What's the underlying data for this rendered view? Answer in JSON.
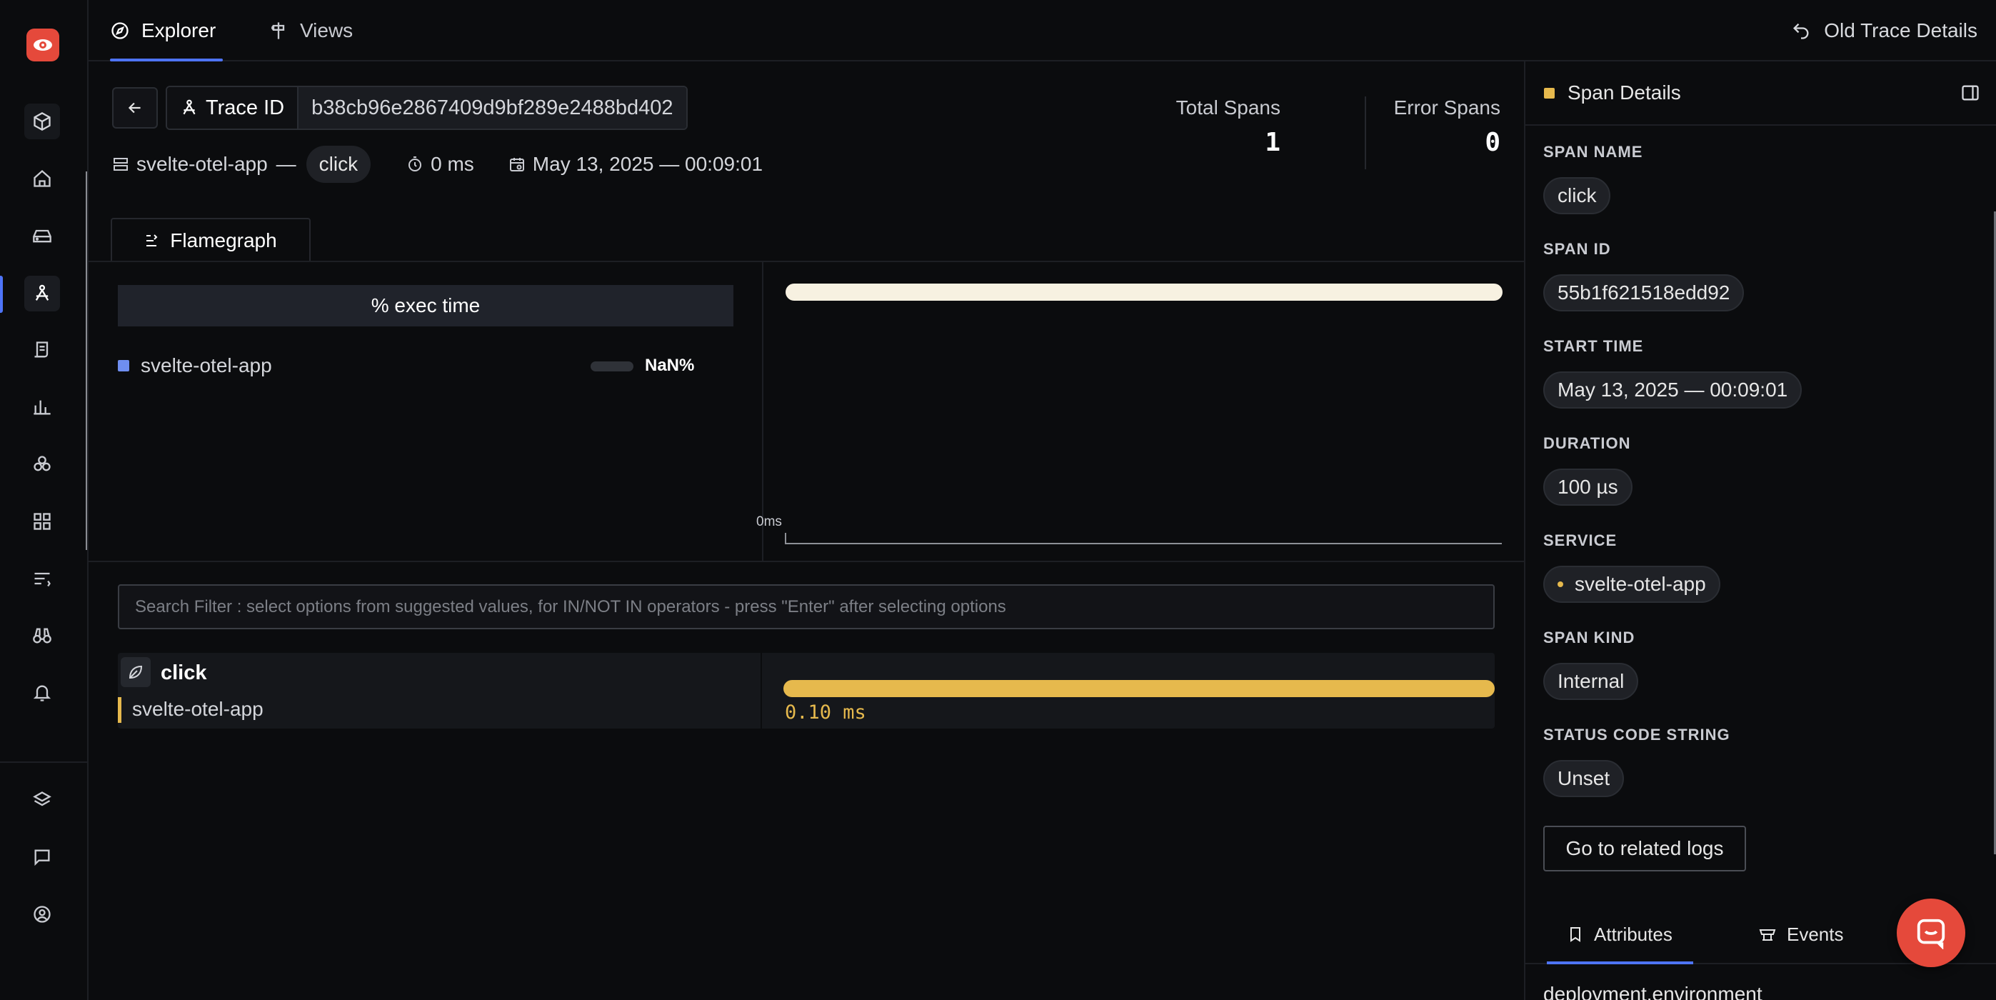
{
  "nav": {
    "tabs": [
      {
        "label": "Explorer",
        "icon": "compass-icon"
      },
      {
        "label": "Views",
        "icon": "signpost-icon"
      }
    ],
    "old_trace_label": "Old Trace Details"
  },
  "sidebar": {
    "items": [
      "logo",
      "get-started",
      "home",
      "services",
      "traces",
      "logs",
      "metrics",
      "infra",
      "dashboards",
      "messaging-queues",
      "explorer",
      "alerts",
      "integrations",
      "support",
      "profile"
    ]
  },
  "trace": {
    "id_label": "Trace ID",
    "id_value": "b38cb96e2867409d9bf289e2488bd402",
    "service": "svelte-otel-app",
    "separator": "—",
    "root_span": "click",
    "duration": "0 ms",
    "timestamp": "May 13, 2025 — 00:09:01"
  },
  "stats": {
    "total_label": "Total Spans",
    "total_value": "1",
    "error_label": "Error Spans",
    "error_value": "0"
  },
  "flamegraph": {
    "tab_label": "Flamegraph",
    "exec_header": "% exec time",
    "services": [
      {
        "name": "svelte-otel-app",
        "percent": "NaN%",
        "color": "#6f8ef0"
      }
    ],
    "axis_start": "0ms",
    "bar_color": "#f7f1e1"
  },
  "search": {
    "placeholder": "Search Filter : select options from suggested values, for IN/NOT IN operators - press \"Enter\" after selecting options"
  },
  "spans": [
    {
      "name": "click",
      "service": "svelte-otel-app",
      "duration": "0.10 ms",
      "color": "#e6b94d"
    }
  ],
  "span_details": {
    "title": "Span Details",
    "fields": [
      {
        "label": "SPAN NAME",
        "value": "click"
      },
      {
        "label": "SPAN ID",
        "value": "55b1f621518edd92"
      },
      {
        "label": "START TIME",
        "value": "May 13, 2025 — 00:09:01"
      },
      {
        "label": "DURATION",
        "value": "100 µs"
      },
      {
        "label": "SERVICE",
        "value": "svelte-otel-app"
      },
      {
        "label": "SPAN KIND",
        "value": "Internal"
      },
      {
        "label": "STATUS CODE STRING",
        "value": "Unset"
      }
    ],
    "logs_button": "Go to related logs",
    "tabs": [
      {
        "label": "Attributes",
        "icon": "bookmark-icon"
      },
      {
        "label": "Events",
        "icon": "events-icon"
      }
    ],
    "first_attribute": "deployment.environment"
  },
  "colors": {
    "accent": "#4e74f8",
    "brand": "#e5493b",
    "span": "#e6b94d"
  }
}
